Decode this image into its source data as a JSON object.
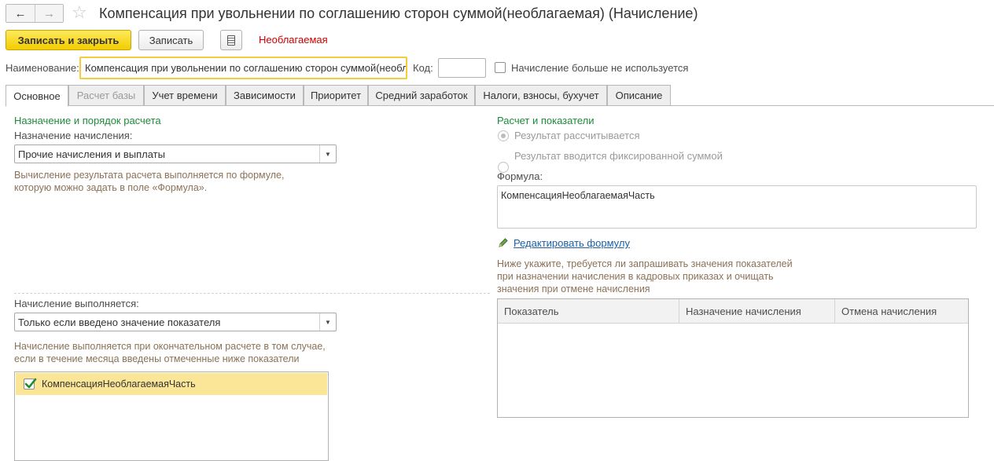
{
  "window": {
    "title": "Компенсация при увольнении по соглашению сторон суммой(необлагаемая) (Начисление)",
    "back_icon": "arrow-left-icon",
    "forward_icon": "arrow-right-icon",
    "favorite_icon": "star-icon"
  },
  "toolbar": {
    "save_close_label": "Записать и закрыть",
    "save_label": "Записать",
    "report_icon": "document-icon",
    "status_text": "Необлагаемая"
  },
  "header": {
    "name_label": "Наименование:",
    "name_value": "Компенсация при увольнении по соглашению сторон суммой(необлагаемая)",
    "code_label": "Код:",
    "code_value": "",
    "unused_label": "Начисление больше не используется",
    "unused_checked": false
  },
  "tabs": [
    {
      "label": "Основное",
      "active": true,
      "disabled": false
    },
    {
      "label": "Расчет базы",
      "active": false,
      "disabled": true
    },
    {
      "label": "Учет времени",
      "active": false,
      "disabled": false
    },
    {
      "label": "Зависимости",
      "active": false,
      "disabled": false
    },
    {
      "label": "Приоритет",
      "active": false,
      "disabled": false
    },
    {
      "label": "Средний заработок",
      "active": false,
      "disabled": false
    },
    {
      "label": "Налоги, взносы, бухучет",
      "active": false,
      "disabled": false
    },
    {
      "label": "Описание",
      "active": false,
      "disabled": false
    }
  ],
  "left": {
    "section_title": "Назначение и порядок расчета",
    "purpose_label": "Назначение начисления:",
    "purpose_value": "Прочие начисления и выплаты",
    "purpose_hint_1": "Вычисление результата расчета выполняется по формуле,",
    "purpose_hint_2": "которую можно задать в поле «Формула».",
    "execute_label": "Начисление выполняется:",
    "execute_value": "Только если введено значение показателя",
    "execute_hint_1": "Начисление выполняется при окончательном расчете в том случае,",
    "execute_hint_2": "если в течение месяца введены отмеченные ниже показатели",
    "indicators": [
      {
        "label": "КомпенсацияНеоблагаемаяЧасть",
        "checked": true
      }
    ]
  },
  "right": {
    "section_title": "Расчет и показатели",
    "radio_calculated": "Результат рассчитывается",
    "radio_fixed": "Результат вводится фиксированной суммой",
    "radio_selected": "calculated",
    "formula_label": "Формула:",
    "formula_value": "КомпенсацияНеоблагаемаяЧасть",
    "edit_formula_link": "Редактировать формулу",
    "edit_icon": "pencil-icon",
    "request_hint_1": "Ниже укажите, требуется ли запрашивать значения показателей",
    "request_hint_2": "при назначении начисления в кадровых приказах и очищать",
    "request_hint_3": "значения при отмене начисления",
    "table_columns": [
      "Показатель",
      "Назначение начисления",
      "Отмена начисления"
    ],
    "table_rows": []
  },
  "colors": {
    "primary_button": "#f5d40f",
    "section_green": "#1e8a3c",
    "hint_brown": "#8a7257",
    "status_red": "#cc0000",
    "link_blue": "#1a5fa8",
    "selected_row": "#fbe596"
  }
}
